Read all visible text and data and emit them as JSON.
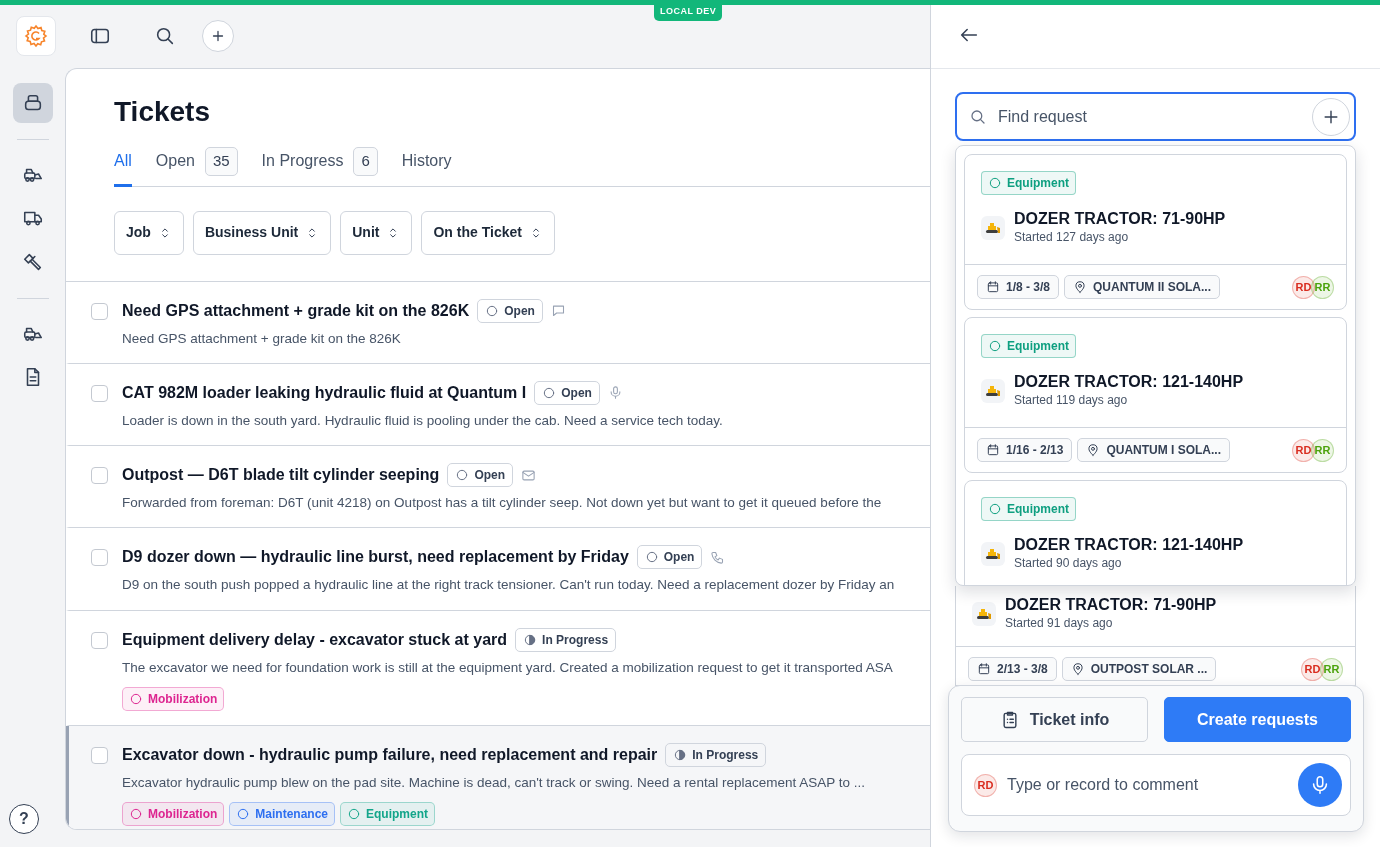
{
  "env_badge": "LOCAL DEV",
  "sidebar": {
    "groups": [
      {
        "items": [
          {
            "kind": "stack",
            "selected": true
          }
        ]
      },
      {
        "items": [
          {
            "kind": "loader",
            "selected": false
          },
          {
            "kind": "truck",
            "selected": false
          },
          {
            "kind": "tools",
            "selected": false
          }
        ]
      },
      {
        "items": [
          {
            "kind": "loader",
            "selected": false
          },
          {
            "kind": "document",
            "selected": false
          }
        ]
      }
    ]
  },
  "help": "?",
  "page_title": "Tickets",
  "tabs": [
    {
      "label": "All",
      "selected": true
    },
    {
      "label": "Open",
      "count": "35",
      "selected": false
    },
    {
      "label": "In Progress",
      "count": "6",
      "selected": false
    },
    {
      "label": "History",
      "selected": false
    }
  ],
  "filters": [
    "Job",
    "Business Unit",
    "Unit",
    "On the Ticket"
  ],
  "tickets": [
    {
      "title": "Need GPS attachment + grade kit on the 826K",
      "status": {
        "label": "Open",
        "kind": "open"
      },
      "kind": "comment",
      "description": "Need GPS attachment + grade kit on the 826K",
      "checked": false,
      "selected": false
    },
    {
      "title": "CAT 982M loader leaking hydraulic fluid at Quantum I",
      "status": {
        "label": "Open",
        "kind": "open"
      },
      "kind": "microphone",
      "description": "Loader is down in the south yard. Hydraulic fluid is pooling under the cab. Need a service tech today.",
      "checked": false,
      "selected": false
    },
    {
      "title": "Outpost — D6T blade tilt cylinder seeping",
      "status": {
        "label": "Open",
        "kind": "open"
      },
      "kind": "mail",
      "description": "Forwarded from foreman: D6T (unit 4218) on Outpost has a tilt cylinder seep. Not down yet but want to get it queued before the",
      "checked": false,
      "selected": false
    },
    {
      "title": "D9 dozer down — hydraulic line burst, need replacement by Friday",
      "status": {
        "label": "Open",
        "kind": "open"
      },
      "kind": "phone",
      "description": "D9 on the south push popped a hydraulic line at the right track tensioner. Can't run today. Need a replacement dozer by Friday an",
      "checked": false,
      "selected": false
    },
    {
      "title": "Equipment delivery delay - excavator stuck at yard",
      "status": {
        "label": "In Progress",
        "kind": "progress"
      },
      "description": "The excavator we need for foundation work is still at the equipment yard. Created a mobilization request to get it transported ASA",
      "tags": [
        {
          "label": "Mobilization",
          "color": "#dd2590"
        }
      ],
      "checked": false,
      "selected": false
    },
    {
      "title": "Excavator down - hydraulic pump failure, need replacement and repair",
      "status": {
        "label": "In Progress",
        "kind": "progress"
      },
      "description": "Excavator hydraulic pump blew on the pad site. Machine is dead, can't track or swing. Need a rental replacement ASAP to ...",
      "tags": [
        {
          "label": "Mobilization",
          "color": "#dd2590"
        },
        {
          "label": "Maintenance",
          "color": "#2e6ff0"
        },
        {
          "label": "Equipment",
          "color": "#12a58a"
        }
      ],
      "checked": false,
      "selected": true
    }
  ],
  "panel": {
    "search": {
      "placeholder": "Find request"
    },
    "suggestions": [
      {
        "tag": {
          "label": "Equipment",
          "color": "#0e9f80"
        },
        "title": "DOZER TRACTOR: 71-90HP",
        "started": "Started 127 days ago",
        "dates": "1/8 - 3/8",
        "location": "QUANTUM II SOLA...",
        "assignees": [
          {
            "initials": "RD",
            "color": "#d92d20"
          },
          {
            "initials": "RR",
            "color": "#4ca30d"
          }
        ]
      },
      {
        "tag": {
          "label": "Equipment",
          "color": "#0e9f80"
        },
        "title": "DOZER TRACTOR: 121-140HP",
        "started": "Started 119 days ago",
        "dates": "1/16 - 2/13",
        "location": "QUANTUM I SOLA...",
        "assignees": [
          {
            "initials": "RD",
            "color": "#d92d20"
          },
          {
            "initials": "RR",
            "color": "#4ca30d"
          }
        ]
      },
      {
        "tag": {
          "label": "Equipment",
          "color": "#0e9f80"
        },
        "title": "DOZER TRACTOR: 121-140HP",
        "started": "Started 90 days ago"
      }
    ],
    "request": {
      "title": "DOZER TRACTOR: 71-90HP",
      "started": "Started 91 days ago",
      "dates": "2/13 - 3/8",
      "location": "OUTPOST SOLAR ...",
      "assignees": [
        {
          "initials": "RD",
          "color": "#d92d20"
        },
        {
          "initials": "RR",
          "color": "#4ca30d"
        }
      ]
    },
    "actions": [
      {
        "label": "Ticket info",
        "kind": "secondary"
      },
      {
        "label": "Create requests",
        "kind": "primary"
      }
    ],
    "comment": {
      "avatar": {
        "initials": "RD",
        "color": "#d92d20"
      },
      "placeholder": "Type or record to comment"
    }
  }
}
